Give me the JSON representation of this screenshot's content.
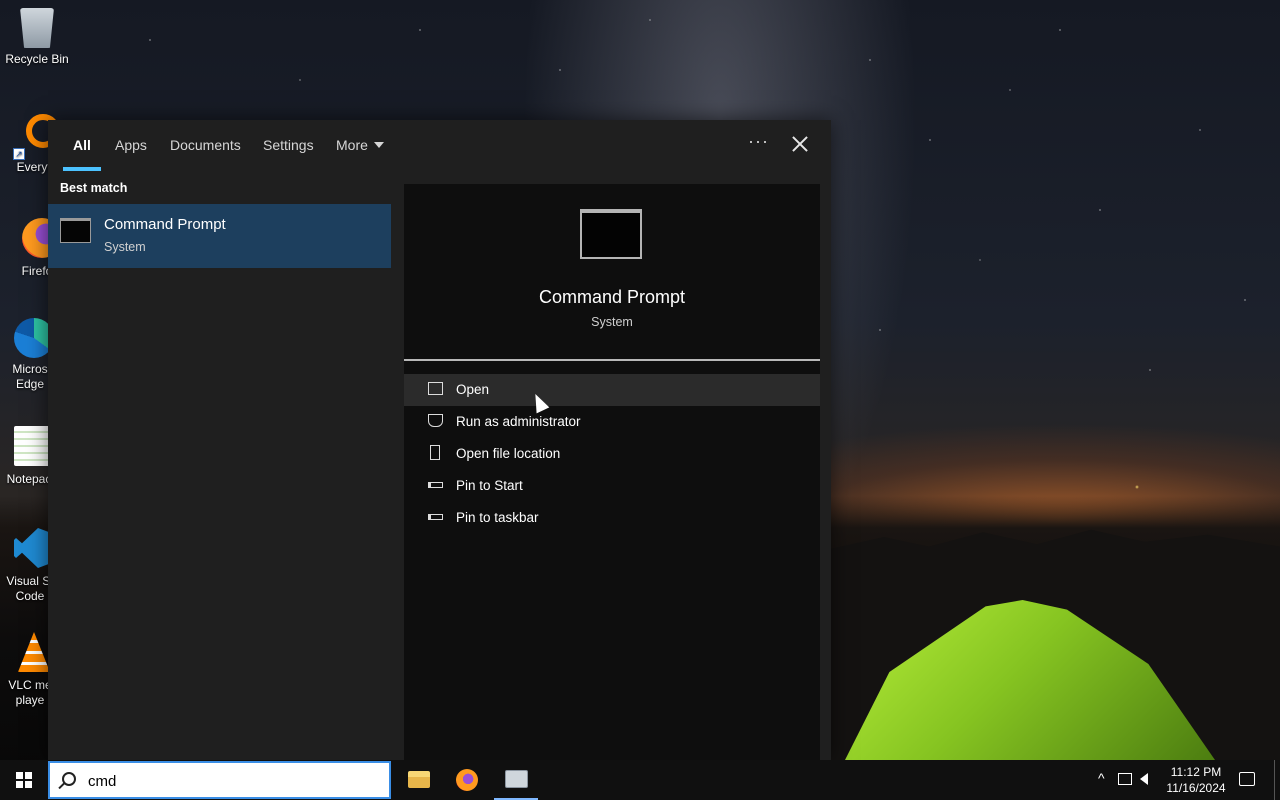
{
  "desktop": {
    "icons": [
      {
        "label": "Recycle Bin",
        "icon": "recycle-bin-icon"
      },
      {
        "label": "Everyth",
        "icon": "everything-search-icon"
      },
      {
        "label": "Firefo",
        "icon": "firefox-icon"
      },
      {
        "label": "Micros Edge",
        "icon": "edge-icon"
      },
      {
        "label": "Notepac",
        "icon": "notepad-plus-icon"
      },
      {
        "label": "Visual St Code",
        "icon": "vscode-icon"
      },
      {
        "label": "VLC me playe",
        "icon": "vlc-icon"
      }
    ]
  },
  "search_panel": {
    "tabs": [
      {
        "label": "All",
        "active": true
      },
      {
        "label": "Apps",
        "active": false
      },
      {
        "label": "Documents",
        "active": false
      },
      {
        "label": "Settings",
        "active": false
      },
      {
        "label": "More",
        "active": false
      }
    ],
    "more_menu_symbol": "···",
    "best_match_label": "Best match",
    "best_match": {
      "title": "Command Prompt",
      "subtitle": "System",
      "icon": "command-prompt-icon"
    },
    "detail": {
      "title": "Command Prompt",
      "subtitle": "System",
      "actions": [
        {
          "label": "Open",
          "icon": "open-icon"
        },
        {
          "label": "Run as administrator",
          "icon": "run-as-admin-icon"
        },
        {
          "label": "Open file location",
          "icon": "file-location-icon"
        },
        {
          "label": "Pin to Start",
          "icon": "pin-icon"
        },
        {
          "label": "Pin to taskbar",
          "icon": "pin-icon"
        }
      ]
    }
  },
  "taskbar": {
    "search_value": "cmd",
    "apps": [
      {
        "name": "File Explorer",
        "icon": "file-explorer-icon"
      },
      {
        "name": "Firefox",
        "icon": "firefox-icon"
      },
      {
        "name": "Search",
        "icon": "search-app-icon"
      }
    ],
    "clock_time": "11:12 PM",
    "clock_date": "11/16/2024"
  },
  "colors": {
    "panel_bg": "#1f1f1f",
    "detail_bg": "#0e0e0e",
    "selected_item": "#1d3f5e",
    "accent": "#4cc2ff",
    "taskbar_bg": "#101010"
  }
}
